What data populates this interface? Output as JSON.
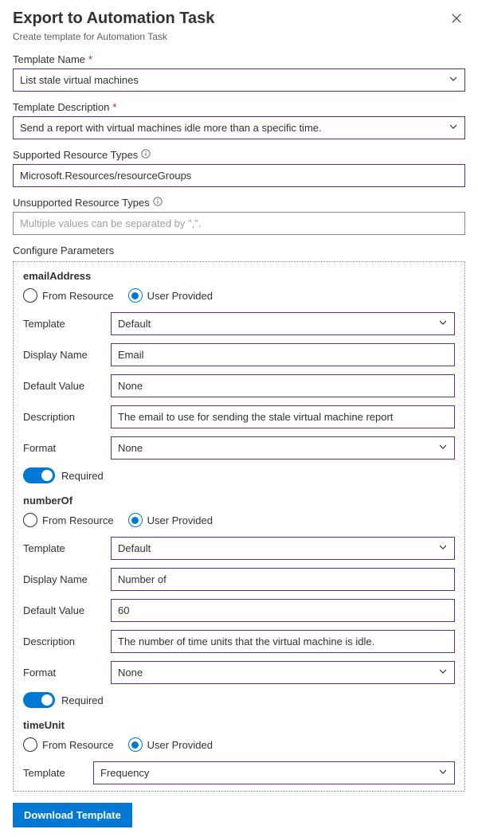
{
  "header": {
    "title": "Export to Automation Task",
    "subtitle": "Create template for Automation Task"
  },
  "fields": {
    "template_name_label": "Template Name",
    "template_name_value": "List stale virtual machines",
    "template_desc_label": "Template Description",
    "template_desc_value": "Send a report with virtual machines idle more than a specific time.",
    "supported_label": "Supported Resource Types",
    "supported_value": "Microsoft.Resources/resourceGroups",
    "unsupported_label": "Unsupported Resource Types",
    "unsupported_placeholder": "Multiple values can be separated by \",\"."
  },
  "configure_label": "Configure Parameters",
  "radio": {
    "from_resource": "From Resource",
    "user_provided": "User Provided"
  },
  "labels": {
    "template": "Template",
    "display_name": "Display Name",
    "default_value": "Default Value",
    "description": "Description",
    "format": "Format",
    "required": "Required"
  },
  "params": [
    {
      "name": "emailAddress",
      "template": "Default",
      "display_name": "Email",
      "default_value": "None",
      "description": "The email to use for sending the stale virtual machine report",
      "format": "None"
    },
    {
      "name": "numberOf",
      "template": "Default",
      "display_name": "Number of",
      "default_value": "60",
      "description": "The number of time units that the virtual machine is idle.",
      "format": "None"
    },
    {
      "name": "timeUnit",
      "template": "Frequency"
    }
  ],
  "download_label": "Download Template"
}
